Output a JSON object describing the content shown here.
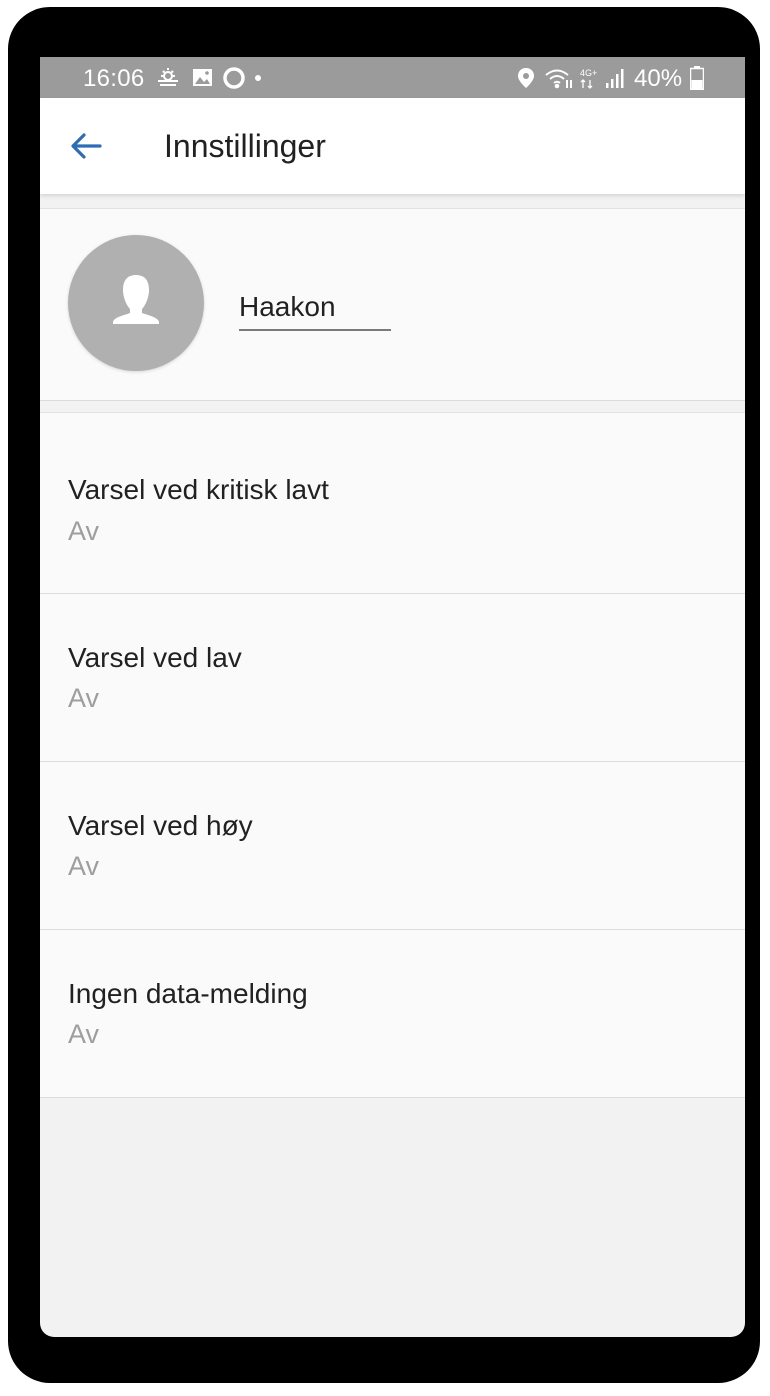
{
  "status_bar": {
    "time": "16:06",
    "battery": "40%",
    "icons": [
      "weather-icon",
      "image-icon",
      "ring-icon",
      "dot-icon",
      "location-icon",
      "wifi-icon",
      "network-4g-icon",
      "signal-icon",
      "battery-icon"
    ],
    "network_label": "4G+"
  },
  "app_bar": {
    "title": "Innstillinger",
    "back_icon": "arrow-back-icon",
    "accent_color": "#2e6db4"
  },
  "profile": {
    "avatar_icon": "person-icon",
    "name": "Haakon"
  },
  "settings": [
    {
      "title": "Varsel ved kritisk lavt",
      "value": "Av"
    },
    {
      "title": "Varsel ved lav",
      "value": "Av"
    },
    {
      "title": "Varsel ved høy",
      "value": "Av"
    },
    {
      "title": "Ingen data-melding",
      "value": "Av"
    }
  ]
}
